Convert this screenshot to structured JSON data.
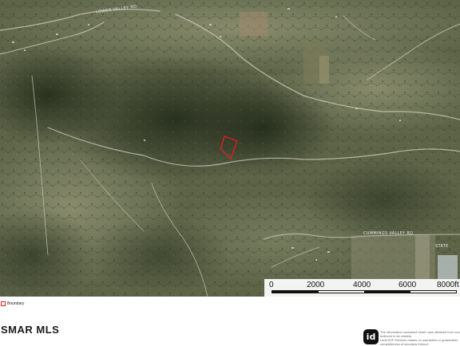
{
  "map": {
    "kind": "satellite-aerial",
    "colors": {
      "terrain_dark": "#3c4630",
      "terrain_light": "#8a8e72",
      "road": "#c8c4b4",
      "boundary": "#e02020"
    },
    "road_labels": [
      "LOWER VALLEY RD",
      "CUMMINGS VALLEY RD",
      "STATE"
    ]
  },
  "scalebar": {
    "ticks": [
      "0",
      "2000",
      "4000",
      "6000",
      "8000ft"
    ],
    "colors": {
      "dark": "#111111",
      "light": "#ffffff"
    }
  },
  "legend": {
    "label": "Boundary"
  },
  "footer": {
    "logo_text": "SMAR MLS",
    "badge_text": "id",
    "disclaimer_lines": [
      "The information contained herein was obtained from sources",
      "believed to be reliable.",
      "Land ID® Services makes no warranties or guarantees",
      "completeness of accuracy thereof."
    ]
  }
}
